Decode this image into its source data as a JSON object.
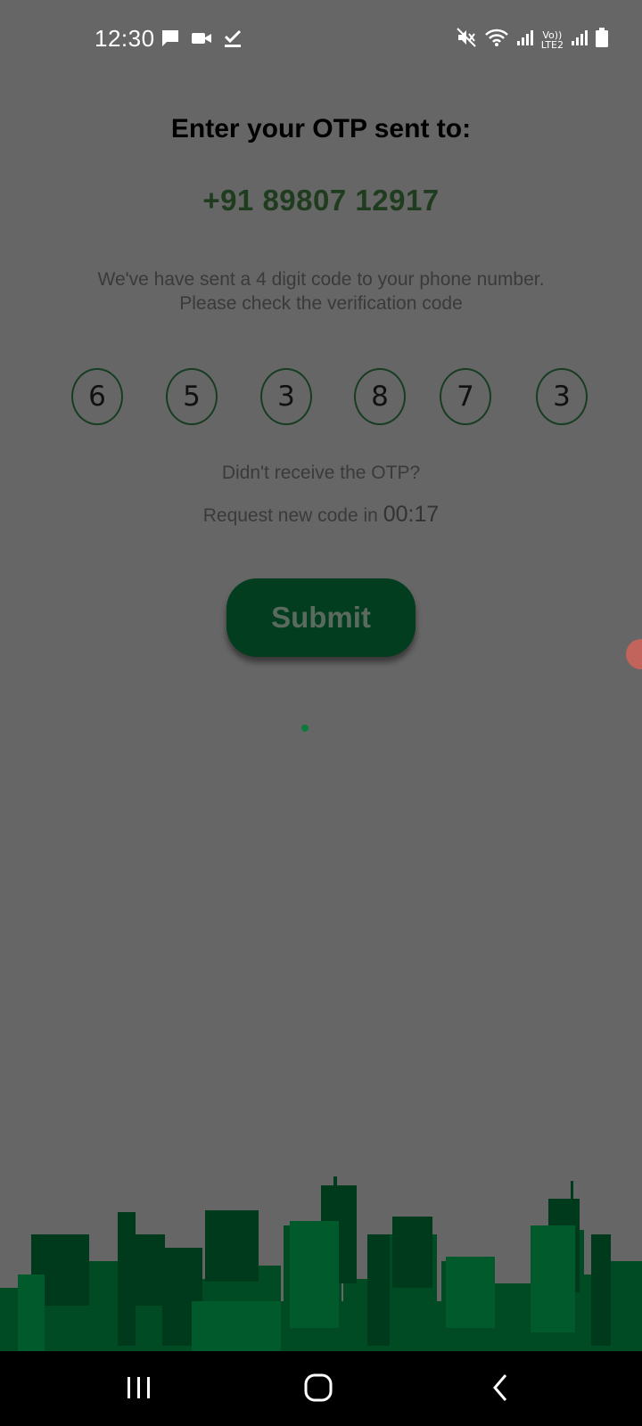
{
  "status_bar": {
    "time": "12:30",
    "left_icons": [
      "message-icon",
      "video-call-icon",
      "download-done-icon"
    ],
    "right_icons": [
      "mute-icon",
      "wifi-icon",
      "signal-icon",
      "volte-lte2-icon",
      "signal-icon-2",
      "battery-icon"
    ],
    "volte_text": "Vo))",
    "lte_text": "LTE2"
  },
  "otp": {
    "title": "Enter your OTP sent to:",
    "phone": "+91 89807 12917",
    "description_line1": "We've have sent a 4 digit code to your phone number.",
    "description_line2": "Please check the verification code",
    "digits": [
      "6",
      "5",
      "3",
      "8",
      "7",
      "3"
    ],
    "didnt_receive": "Didn't receive the OTP?",
    "request_prefix": "Request new code in",
    "timer": "00:17",
    "submit_label": "Submit"
  },
  "nav_bar": {
    "icons": [
      "recent-apps-icon",
      "home-icon",
      "back-icon"
    ]
  },
  "colors": {
    "background": "#666666",
    "phone_text": "#1f3c1f",
    "button": "#013d1e",
    "otp_border": "#163d22",
    "skyline_dark": "#003a1c",
    "skyline_mid": "#004d25",
    "nav_bar": "#000000"
  }
}
